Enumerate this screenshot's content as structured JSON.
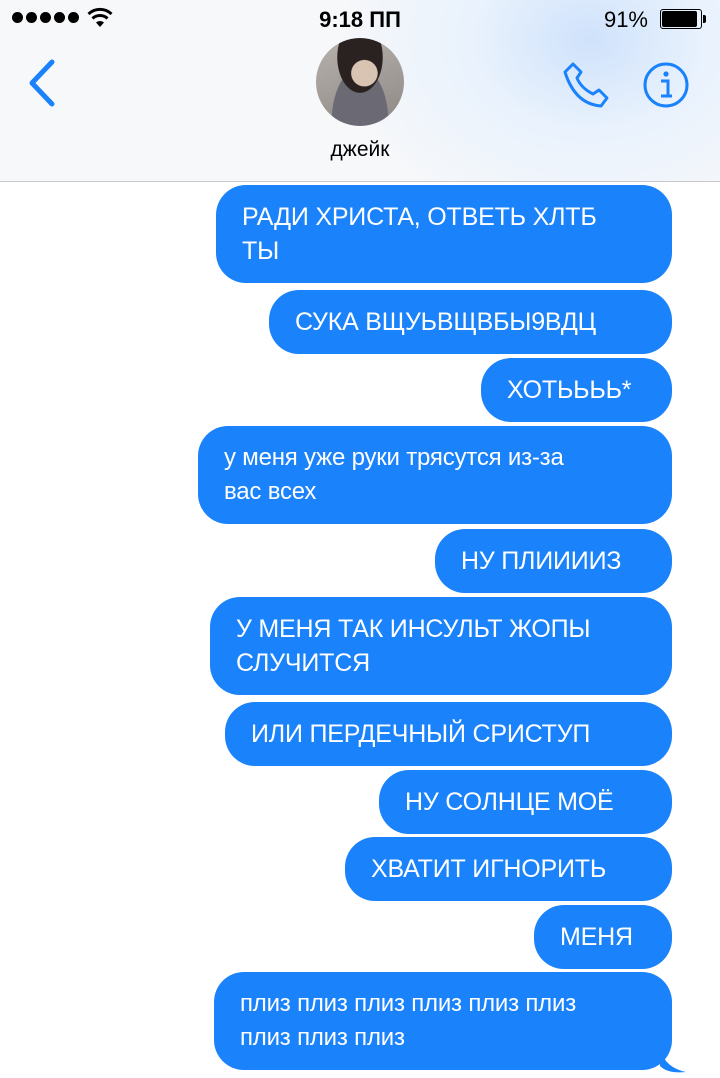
{
  "status_bar": {
    "time": "9:18 ПП",
    "battery_percent": "91%",
    "battery_level": 0.91,
    "signal_bars": 5
  },
  "header": {
    "contact_name": "джейк",
    "icons": [
      "back-chevron-icon",
      "phone-icon",
      "info-icon"
    ],
    "accent_color": "#1a82fb"
  },
  "messages": [
    {
      "lines": [
        "РАДИ ХРИСТА, ОТВЕТЬ ХЛТБ",
        "ТЫ"
      ]
    },
    {
      "lines": [
        "СУКА ВЩУЬВЩВБЫ9ВДЦ"
      ]
    },
    {
      "lines": [
        "ХОТЬЬЬЬ*"
      ]
    },
    {
      "lines": [
        "у меня уже руки трясутся из-за",
        "вас всех"
      ]
    },
    {
      "lines": [
        "НУ ПЛИИИИЗ"
      ]
    },
    {
      "lines": [
        "У МЕНЯ ТАК ИНСУЛЬТ ЖОПЫ",
        "СЛУЧИТСЯ"
      ]
    },
    {
      "lines": [
        "ИЛИ ПЕРДЕЧНЫЙ СРИСТУП"
      ]
    },
    {
      "lines": [
        "НУ СОЛНЦЕ МОЁ"
      ]
    },
    {
      "lines": [
        "ХВАТИТ ИГНОРИТЬ"
      ]
    },
    {
      "lines": [
        "МЕНЯ"
      ]
    },
    {
      "lines": [
        "плиз плиз плиз плиз плиз плиз",
        "плиз плиз плиз"
      ]
    }
  ]
}
